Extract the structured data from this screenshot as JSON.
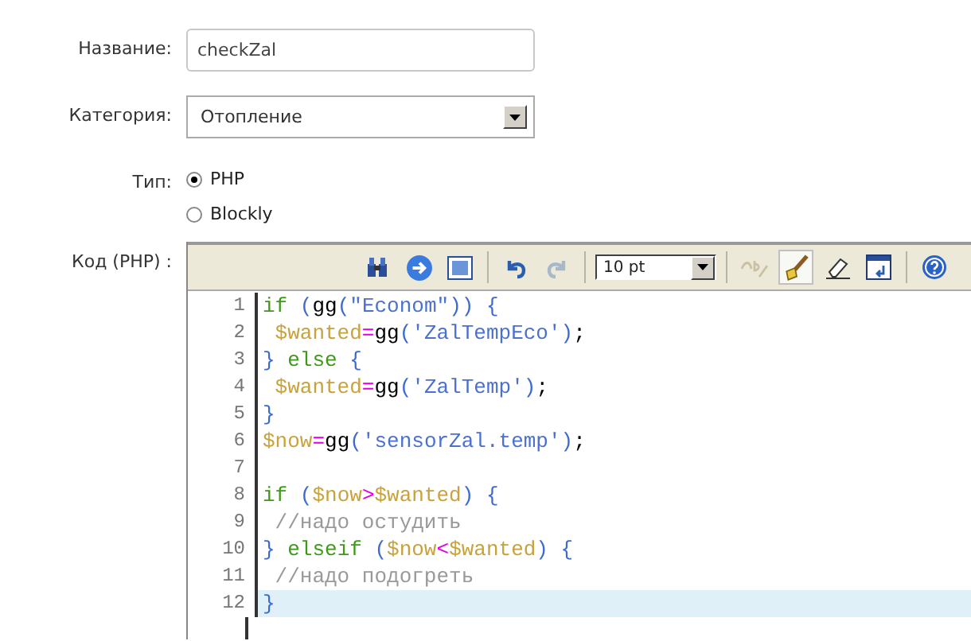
{
  "form": {
    "name": {
      "label": "Название:",
      "value": "checkZal"
    },
    "category": {
      "label": "Категория:",
      "value": "Отопление"
    },
    "type": {
      "label": "Тип:",
      "options": [
        {
          "label": "PHP",
          "selected": true
        },
        {
          "label": "Blockly",
          "selected": false
        }
      ]
    },
    "code": {
      "label": "Код (PHP) :"
    }
  },
  "toolbar": {
    "buttons": [
      {
        "kind": "find",
        "disabled": false,
        "pressed": false
      },
      {
        "kind": "goto",
        "disabled": false,
        "pressed": false
      },
      {
        "kind": "fullscreen",
        "disabled": false,
        "pressed": false
      },
      {
        "kind": "undo",
        "disabled": false,
        "pressed": false
      },
      {
        "kind": "redo",
        "disabled": true,
        "pressed": false
      }
    ],
    "font_size": "10 pt",
    "buttons_after": [
      {
        "kind": "spellcheck",
        "disabled": true,
        "pressed": false
      },
      {
        "kind": "highlight",
        "disabled": false,
        "pressed": true
      },
      {
        "kind": "erase",
        "disabled": false,
        "pressed": false
      },
      {
        "kind": "reset",
        "disabled": false,
        "pressed": false
      },
      {
        "kind": "help",
        "disabled": false,
        "pressed": false
      }
    ]
  },
  "editor": {
    "lines": [
      {
        "number": "1",
        "active": false,
        "tokens": [
          {
            "kind": "keyword",
            "text": "if"
          },
          {
            "kind": "paren",
            "text": " ("
          },
          {
            "kind": "func",
            "text": "gg"
          },
          {
            "kind": "paren",
            "text": "("
          },
          {
            "kind": "string",
            "text": "\"Econom\""
          },
          {
            "kind": "paren",
            "text": ")) {"
          }
        ]
      },
      {
        "number": "2",
        "active": false,
        "tokens": [
          {
            "kind": "var",
            "text": " $wanted"
          },
          {
            "kind": "op",
            "text": "="
          },
          {
            "kind": "func",
            "text": "gg"
          },
          {
            "kind": "paren",
            "text": "("
          },
          {
            "kind": "string",
            "text": "'ZalTempEco'"
          },
          {
            "kind": "paren",
            "text": ")"
          },
          {
            "kind": "func",
            "text": ";"
          }
        ]
      },
      {
        "number": "3",
        "active": false,
        "tokens": [
          {
            "kind": "paren",
            "text": "}"
          },
          {
            "kind": "keyword",
            "text": " else"
          },
          {
            "kind": "paren",
            "text": " {"
          }
        ]
      },
      {
        "number": "4",
        "active": false,
        "tokens": [
          {
            "kind": "var",
            "text": " $wanted"
          },
          {
            "kind": "op",
            "text": "="
          },
          {
            "kind": "func",
            "text": "gg"
          },
          {
            "kind": "paren",
            "text": "("
          },
          {
            "kind": "string",
            "text": "'ZalTemp'"
          },
          {
            "kind": "paren",
            "text": ")"
          },
          {
            "kind": "func",
            "text": ";"
          }
        ]
      },
      {
        "number": "5",
        "active": false,
        "tokens": [
          {
            "kind": "paren",
            "text": "}"
          }
        ]
      },
      {
        "number": "6",
        "active": false,
        "tokens": [
          {
            "kind": "var",
            "text": "$now"
          },
          {
            "kind": "op",
            "text": "="
          },
          {
            "kind": "func",
            "text": "gg"
          },
          {
            "kind": "paren",
            "text": "("
          },
          {
            "kind": "string",
            "text": "'sensorZal.temp'"
          },
          {
            "kind": "paren",
            "text": ")"
          },
          {
            "kind": "func",
            "text": ";"
          }
        ]
      },
      {
        "number": "7",
        "active": false
      },
      {
        "number": "8",
        "active": false,
        "tokens": [
          {
            "kind": "keyword",
            "text": "if"
          },
          {
            "kind": "paren",
            "text": " ("
          },
          {
            "kind": "var",
            "text": "$now"
          },
          {
            "kind": "op",
            "text": ">"
          },
          {
            "kind": "var",
            "text": "$wanted"
          },
          {
            "kind": "paren",
            "text": ") {"
          }
        ]
      },
      {
        "number": "9",
        "active": false,
        "tokens": [
          {
            "kind": "comment",
            "text": " //надо остудить"
          }
        ]
      },
      {
        "number": "10",
        "active": false,
        "tokens": [
          {
            "kind": "paren",
            "text": "}"
          },
          {
            "kind": "keyword",
            "text": " elseif"
          },
          {
            "kind": "paren",
            "text": " ("
          },
          {
            "kind": "var",
            "text": "$now"
          },
          {
            "kind": "op",
            "text": "<"
          },
          {
            "kind": "var",
            "text": "$wanted"
          },
          {
            "kind": "paren",
            "text": ") {"
          }
        ]
      },
      {
        "number": "11",
        "active": false,
        "tokens": [
          {
            "kind": "comment",
            "text": " //надо подогреть"
          }
        ]
      },
      {
        "number": "12",
        "active": true,
        "tokens": [
          {
            "kind": "paren",
            "text": "}"
          }
        ]
      }
    ]
  }
}
